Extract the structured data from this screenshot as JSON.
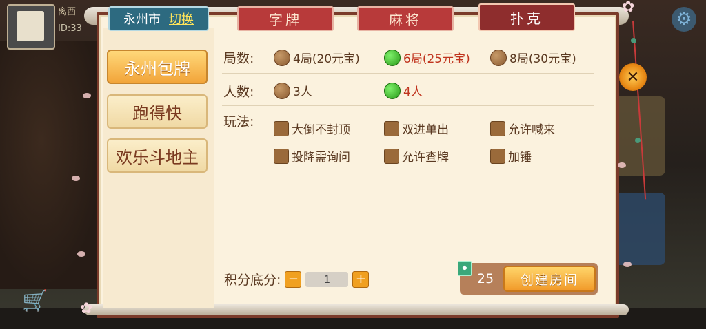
{
  "player": {
    "name": "离西",
    "id": "ID:33"
  },
  "city": {
    "name": "永州市",
    "switch_label": "切换"
  },
  "tabs": [
    {
      "label": "字牌",
      "active": false
    },
    {
      "label": "麻将",
      "active": false
    },
    {
      "label": "扑克",
      "active": true
    }
  ],
  "categories": [
    {
      "label": "永州包牌",
      "active": true
    },
    {
      "label": "跑得快",
      "active": false
    },
    {
      "label": "欢乐斗地主",
      "active": false
    }
  ],
  "rounds": {
    "label": "局数:",
    "options": [
      {
        "label": "4局(20元宝)",
        "selected": false
      },
      {
        "label": "6局(25元宝)",
        "selected": true
      },
      {
        "label": "8局(30元宝)",
        "selected": false
      }
    ]
  },
  "players": {
    "label": "人数:",
    "options": [
      {
        "label": "3人",
        "selected": false
      },
      {
        "label": "4人",
        "selected": true
      }
    ]
  },
  "rules": {
    "label": "玩法:",
    "options": [
      {
        "label": "大倒不封顶",
        "checked": false
      },
      {
        "label": "双进单出",
        "checked": false
      },
      {
        "label": "允许喊来",
        "checked": false
      },
      {
        "label": "投降需询问",
        "checked": false
      },
      {
        "label": "允许查牌",
        "checked": false
      },
      {
        "label": "加锤",
        "checked": false
      }
    ]
  },
  "score": {
    "label": "积分底分:",
    "minus": "−",
    "value": "1",
    "plus": "+"
  },
  "create": {
    "cost": "25",
    "label": "创建房间"
  },
  "colors": {
    "accent": "#f19a2a",
    "selected": "#c0341e",
    "frame": "#7a3b2a"
  }
}
